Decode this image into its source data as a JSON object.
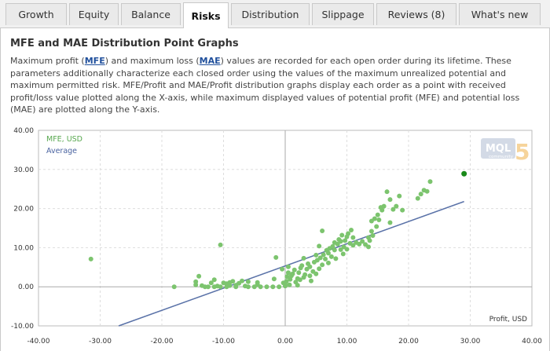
{
  "tabs": [
    {
      "label": "Growth",
      "active": false
    },
    {
      "label": "Equity",
      "active": false
    },
    {
      "label": "Balance",
      "active": false
    },
    {
      "label": "Risks",
      "active": true
    },
    {
      "label": "Distribution",
      "active": false
    },
    {
      "label": "Slippage",
      "active": false
    },
    {
      "label": "Reviews (8)",
      "active": false
    },
    {
      "label": "What's new",
      "active": false
    }
  ],
  "section": {
    "title": "MFE and MAE Distribution Point Graphs",
    "desc_p1": "Maximum profit (",
    "mfe_link": "MFE",
    "desc_p2": ") and maximum loss (",
    "mae_link": "MAE",
    "desc_p3": ") values are recorded for each open order during its lifetime. These parameters additionally characterize each closed order using the values of the maximum unrealized potential and maximum permitted risk. MFE/Profit and MAE/Profit distribution graphs display each order as a point with received profit/loss value plotted along the X-axis, while maximum displayed values of potential profit (MFE) and potential loss (MAE) are plotted along the Y-axis."
  },
  "logo": {
    "text": "MQL",
    "number": "5",
    "sub": "community"
  },
  "colors": {
    "mfe": "#7cc46e",
    "highlight": "#1a8a1a",
    "average": "#5a72a8",
    "grid": "#dddddd",
    "axis": "#aaaaaa"
  },
  "chart_data": {
    "type": "scatter",
    "xlabel": "Profit, USD",
    "xlim": [
      -40,
      40
    ],
    "ylim": [
      -10,
      40
    ],
    "x_ticks": [
      "-40.00",
      "-30.00",
      "-20.00",
      "-10.00",
      "0.00",
      "10.00",
      "20.00",
      "30.00",
      "40.00"
    ],
    "y_ticks": [
      "40.00",
      "30.00",
      "20.00",
      "10.00",
      "0.00",
      "-10.00"
    ],
    "grid": true,
    "legend_position": "top-left",
    "series": [
      {
        "name": "MFE, USD",
        "type": "scatter",
        "points": [
          [
            -31.5,
            7.1
          ],
          [
            -18,
            0
          ],
          [
            -14.5,
            0.5
          ],
          [
            -14.5,
            1.3
          ],
          [
            -14,
            2.7
          ],
          [
            -13.5,
            0.3
          ],
          [
            -13,
            0
          ],
          [
            -12.5,
            0
          ],
          [
            -12,
            1
          ],
          [
            -11.5,
            1.8
          ],
          [
            -11.5,
            0
          ],
          [
            -11,
            0.2
          ],
          [
            -10.5,
            0
          ],
          [
            -10.5,
            10.7
          ],
          [
            -10,
            1
          ],
          [
            -9.5,
            0
          ],
          [
            -9.5,
            0.8
          ],
          [
            -9,
            1.1
          ],
          [
            -9,
            0.3
          ],
          [
            -8.5,
            1.4
          ],
          [
            -8,
            0
          ],
          [
            -8,
            0.4
          ],
          [
            -7.5,
            0.9
          ],
          [
            -7,
            1.5
          ],
          [
            -6.5,
            0.2
          ],
          [
            -6,
            1.3
          ],
          [
            -6,
            0
          ],
          [
            -5,
            0
          ],
          [
            -4.5,
            0.6
          ],
          [
            -4.5,
            1.1
          ],
          [
            -4,
            0
          ],
          [
            -3,
            0
          ],
          [
            -2,
            0
          ],
          [
            -1.8,
            2
          ],
          [
            -1.5,
            7.5
          ],
          [
            -1,
            0
          ],
          [
            -0.5,
            4.5
          ],
          [
            -0.3,
            1
          ],
          [
            0,
            0.2
          ],
          [
            0,
            0.6
          ],
          [
            0.2,
            1.4
          ],
          [
            0.3,
            2.6
          ],
          [
            0.5,
            3.6
          ],
          [
            0.5,
            5.1
          ],
          [
            0.7,
            0.5
          ],
          [
            0.8,
            1.9
          ],
          [
            1,
            2.8
          ],
          [
            1.2,
            3.3
          ],
          [
            1.5,
            4.3
          ],
          [
            1.7,
            1.2
          ],
          [
            2,
            0.4
          ],
          [
            2,
            2.1
          ],
          [
            2.2,
            3.6
          ],
          [
            2.4,
            1.8
          ],
          [
            2.5,
            4.8
          ],
          [
            2.7,
            5.4
          ],
          [
            3,
            2.4
          ],
          [
            3,
            7.3
          ],
          [
            3.2,
            3.1
          ],
          [
            3.5,
            4.5
          ],
          [
            3.7,
            5.9
          ],
          [
            4,
            2.8
          ],
          [
            4,
            5.1
          ],
          [
            4.2,
            1.5
          ],
          [
            4.5,
            3.9
          ],
          [
            4.7,
            6.3
          ],
          [
            5,
            3.3
          ],
          [
            5,
            8.1
          ],
          [
            5.2,
            6.8
          ],
          [
            5.5,
            4.6
          ],
          [
            5.5,
            10.4
          ],
          [
            5.7,
            7.4
          ],
          [
            6,
            5.6
          ],
          [
            6,
            14.3
          ],
          [
            6.2,
            8.2
          ],
          [
            6.5,
            7.1
          ],
          [
            6.7,
            9.3
          ],
          [
            7,
            6.1
          ],
          [
            7,
            8.6
          ],
          [
            7.2,
            9.8
          ],
          [
            7.5,
            7.7
          ],
          [
            7.7,
            10.3
          ],
          [
            8,
            9.4
          ],
          [
            8,
            11.3
          ],
          [
            8.2,
            7.2
          ],
          [
            8.5,
            10.9
          ],
          [
            8.7,
            12.1
          ],
          [
            9,
            9.5
          ],
          [
            9,
            11.6
          ],
          [
            9.2,
            13.2
          ],
          [
            9.4,
            8.4
          ],
          [
            9.5,
            10.2
          ],
          [
            9.7,
            11.8
          ],
          [
            10,
            12.8
          ],
          [
            10,
            9.6
          ],
          [
            10.2,
            13.6
          ],
          [
            10.5,
            11.1
          ],
          [
            10.7,
            14.5
          ],
          [
            11,
            10.6
          ],
          [
            11,
            12.6
          ],
          [
            11.5,
            11.3
          ],
          [
            12,
            10.9
          ],
          [
            12.5,
            11.6
          ],
          [
            13,
            10.8
          ],
          [
            13.5,
            10.2
          ],
          [
            13.5,
            12.6
          ],
          [
            13.7,
            11.8
          ],
          [
            14,
            14.2
          ],
          [
            14,
            16.8
          ],
          [
            14.2,
            13.1
          ],
          [
            14.5,
            17.4
          ],
          [
            14.8,
            15.4
          ],
          [
            15,
            18.4
          ],
          [
            15.2,
            17.1
          ],
          [
            15.5,
            20.3
          ],
          [
            15.7,
            19.6
          ],
          [
            16,
            20.6
          ],
          [
            16.5,
            24.3
          ],
          [
            17,
            16.4
          ],
          [
            17,
            22.3
          ],
          [
            17.5,
            19.8
          ],
          [
            18,
            20.6
          ],
          [
            18.5,
            23.2
          ],
          [
            19,
            19.6
          ],
          [
            21.5,
            22.6
          ],
          [
            22,
            23.7
          ],
          [
            22.5,
            24.7
          ],
          [
            23,
            24.4
          ],
          [
            23.5,
            26.9
          ]
        ]
      },
      {
        "name": "",
        "type": "highlight",
        "points": [
          [
            29,
            28.9
          ]
        ]
      },
      {
        "name": "Average",
        "type": "line",
        "points": [
          [
            -27,
            -10
          ],
          [
            29,
            21.8
          ]
        ]
      }
    ]
  }
}
